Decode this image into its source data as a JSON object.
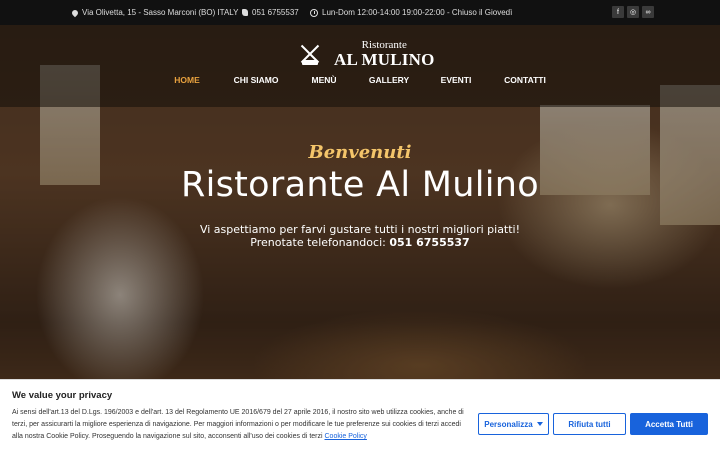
{
  "topbar": {
    "address": "Via Olivetta, 15 - Sasso Marconi (BO) ITALY",
    "phone": "051 6755537",
    "hours": "Lun-Dom 12:00-14:00 19:00-22:00 - Chiuso il Giovedì",
    "social": [
      {
        "icon": "facebook-icon",
        "glyph": "f"
      },
      {
        "icon": "instagram-icon",
        "glyph": "◎"
      },
      {
        "icon": "tripadvisor-icon",
        "glyph": "∞"
      }
    ]
  },
  "logo": {
    "small": "Ristorante",
    "big": "AL MULINO"
  },
  "nav": [
    {
      "label": "HOME",
      "active": true
    },
    {
      "label": "CHI SIAMO",
      "active": false
    },
    {
      "label": "MENÙ",
      "active": false
    },
    {
      "label": "GALLERY",
      "active": false
    },
    {
      "label": "EVENTI",
      "active": false
    },
    {
      "label": "CONTATTI",
      "active": false
    }
  ],
  "hero": {
    "welcome": "Benvenuti",
    "title": "Ristorante Al Mulino",
    "line1": "Vi aspettiamo per farvi gustare tutti i nostri migliori piatti!",
    "line2_prefix": "Prenotate telefonandoci: ",
    "line2_phone": "051 6755537"
  },
  "cookie": {
    "title": "We value your privacy",
    "text": "Ai sensi dell'art.13 del D.Lgs. 196/2003 e dell'art. 13 del Regolamento UE 2016/679 del 27 aprile 2016, il nostro sito web utilizza cookies, anche di terzi, per assicurarti la migliore esperienza di navigazione. Per maggiori informazioni o per modificare le tue preferenze sui cookies di terzi accedi alla nostra Cookie Policy. Proseguendo la navigazione sul sito, acconsenti all'uso dei cookies di terzi ",
    "link": "Cookie Policy",
    "customize": "Personalizza",
    "reject": "Rifiuta tutti",
    "accept": "Accetta Tutti"
  },
  "colors": {
    "accent": "#e8a13e",
    "welcome": "#f4c56a",
    "cookie_blue": "#1863dc"
  }
}
